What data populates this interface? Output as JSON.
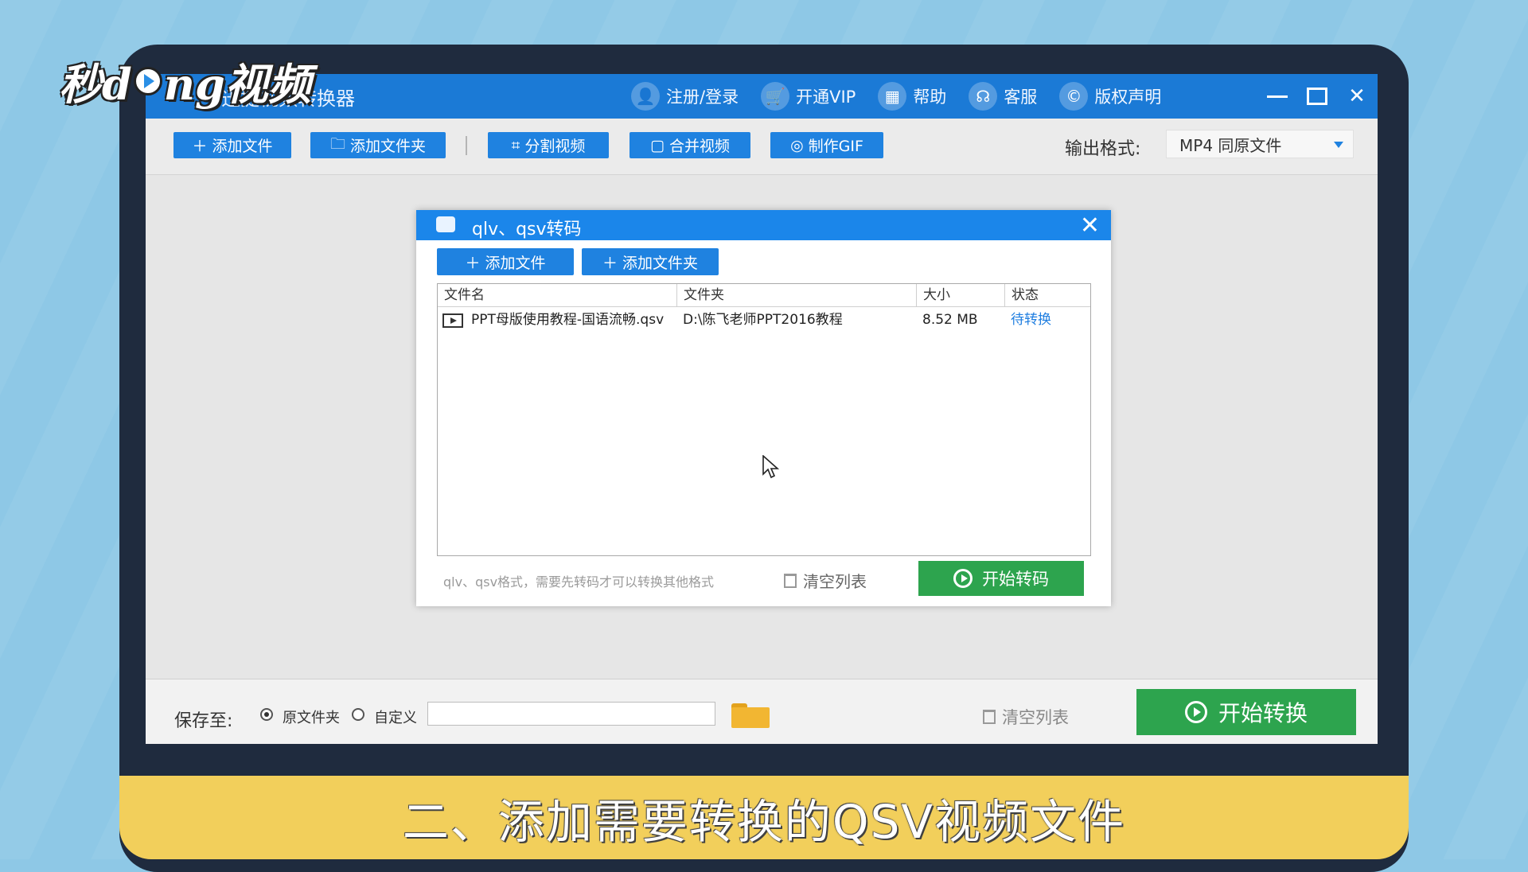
{
  "logo": {
    "text_a": "秒d",
    "text_b": "ng视频"
  },
  "caption": "二、添加需要转换的QSV视频文件",
  "app": {
    "title": "迅捷视频转换器",
    "title_actions": [
      {
        "label": "注册/登录",
        "icon": "user-icon",
        "glyph": "👤"
      },
      {
        "label": "开通VIP",
        "icon": "cart-icon",
        "glyph": "🛒"
      },
      {
        "label": "帮助",
        "icon": "grid-icon",
        "glyph": "▦"
      },
      {
        "label": "客服",
        "icon": "headset-icon",
        "glyph": "☊"
      },
      {
        "label": "版权声明",
        "icon": "copyright-icon",
        "glyph": "©"
      }
    ],
    "toolbar": {
      "add_file": "添加文件",
      "add_folder": "添加文件夹",
      "split_video": "分割视频",
      "merge_video": "合并视频",
      "make_gif": "制作GIF",
      "output_label": "输出格式:",
      "output_value": "MP4  同原文件"
    },
    "bottom": {
      "save_to": "保存至:",
      "radio_original": "原文件夹",
      "radio_custom": "自定义",
      "path_value": "",
      "clear_list": "清空列表",
      "start_convert": "开始转换"
    }
  },
  "dialog": {
    "title": "qlv、qsv转码",
    "add_file": "添加文件",
    "add_folder": "添加文件夹",
    "columns": [
      "文件名",
      "文件夹",
      "大小",
      "状态"
    ],
    "rows": [
      {
        "name": "PPT母版使用教程-国语流畅.qsv",
        "folder": "D:\\陈飞老师PPT2016教程",
        "size": "8.52 MB",
        "status": "待转换"
      }
    ],
    "hint": "qlv、qsv格式，需要先转码才可以转换其他格式",
    "clear_list": "清空列表",
    "start_transcode": "开始转码"
  },
  "colors": {
    "brand_blue": "#1b7ad6",
    "start_green": "#2da44e",
    "caption_band": "#f2cf5b"
  }
}
